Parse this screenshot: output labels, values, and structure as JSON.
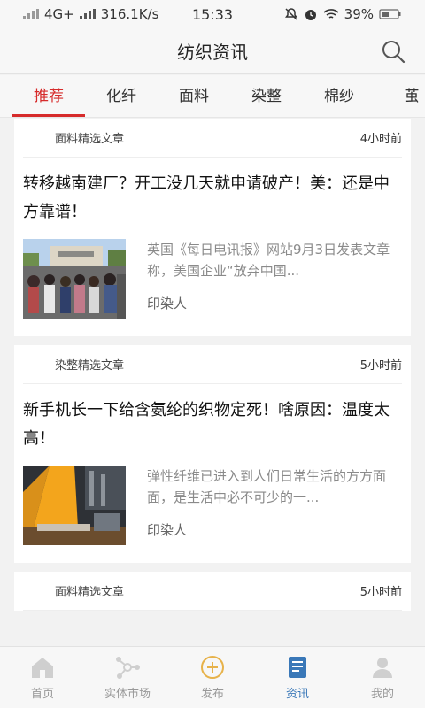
{
  "status_bar": {
    "network": "4G+",
    "speed": "316.1K/s",
    "time": "15:33",
    "battery": "39%"
  },
  "header": {
    "title": "纺织资讯",
    "search_icon": "search-icon"
  },
  "tabs": [
    {
      "label": "推荐",
      "active": true
    },
    {
      "label": "化纤"
    },
    {
      "label": "面料"
    },
    {
      "label": "染整"
    },
    {
      "label": "棉纱"
    },
    {
      "label": "茧"
    }
  ],
  "articles": [
    {
      "category": "面料精选文章",
      "time": "4小时前",
      "headline": "转移越南建厂？开工没几天就申请破产！美：还是中方靠谱！",
      "summary": "英国《每日电讯报》网站9月3日发表文章称，美国企业“放弃中国...",
      "source": "印染人"
    },
    {
      "category": "染整精选文章",
      "time": "5小时前",
      "headline": "新手机长一下给含氨纶的织物定死！啥原因：温度太高！",
      "summary": "弹性纤维已进入到人们日常生活的方方面面，是生活中必不可少的一...",
      "source": "印染人"
    },
    {
      "category": "面料精选文章",
      "time": "5小时前"
    }
  ],
  "bottom_nav": [
    {
      "label": "首页",
      "icon": "home-icon"
    },
    {
      "label": "实体市场",
      "icon": "market-icon"
    },
    {
      "label": "发布",
      "icon": "publish-icon"
    },
    {
      "label": "资讯",
      "icon": "news-icon",
      "active": true
    },
    {
      "label": "我的",
      "icon": "profile-icon"
    }
  ],
  "colors": {
    "accent": "#d62b2b",
    "nav_active": "#3a78b8"
  }
}
